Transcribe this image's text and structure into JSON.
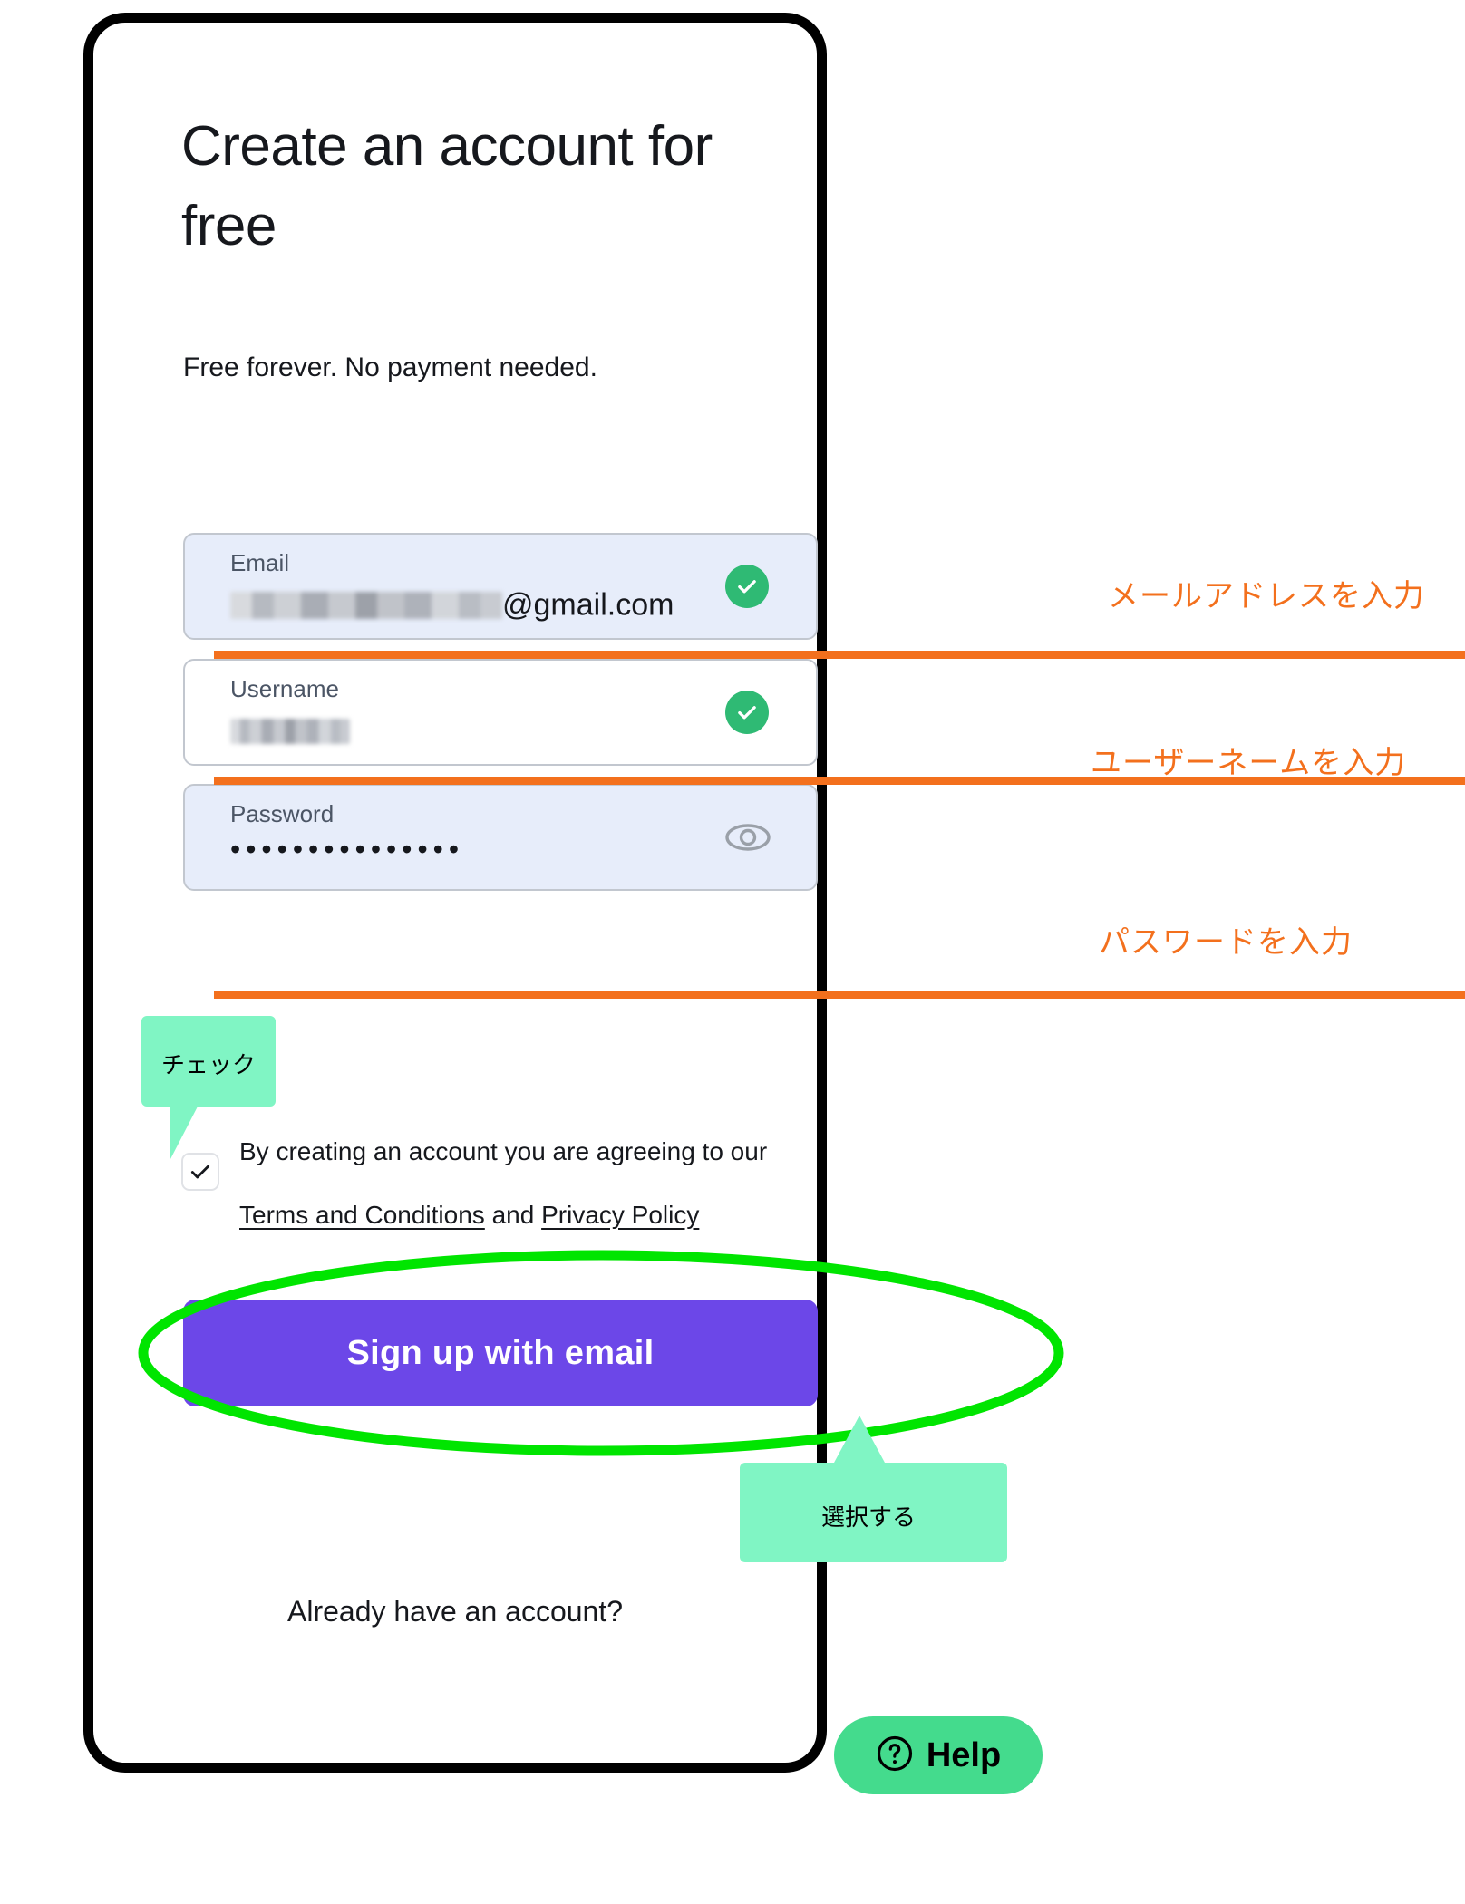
{
  "screen": {
    "title": "Create an account for free",
    "subtitle": "Free forever. No payment needed."
  },
  "form": {
    "email": {
      "label": "Email",
      "value_redacted": true,
      "value_suffix": "@gmail.com",
      "status_icon": "check-circle-icon",
      "state": "valid"
    },
    "username": {
      "label": "Username",
      "value_redacted": true,
      "status_icon": "check-circle-icon",
      "state": "valid"
    },
    "password": {
      "label": "Password",
      "value_masked": "•••••••••••••••",
      "status_icon": "eye-icon",
      "state": "filled"
    }
  },
  "terms": {
    "checked": true,
    "text_before": "By creating an account you are agreeing to our ",
    "link_terms": "Terms and Conditions",
    "text_middle": " and ",
    "link_privacy": "Privacy Policy"
  },
  "actions": {
    "signup_label": "Sign up with email",
    "already_account": "Already have an account?",
    "help_label": "Help",
    "help_icon": "question-circle-icon"
  },
  "annotations": {
    "note_email": "メールアドレスを入力",
    "note_username": "ユーザーネームを入力",
    "note_password": "パスワードを入力",
    "callout_check": "チェック",
    "callout_select": "選択する"
  },
  "colors": {
    "accent_purple": "#6c47e8",
    "annotation_orange": "#f3701d",
    "callout_mint": "#80f5c4",
    "highlight_green": "#00e500",
    "success_green": "#2fba74",
    "help_green": "#44db8d",
    "field_filled_bg": "#e7edfa"
  }
}
